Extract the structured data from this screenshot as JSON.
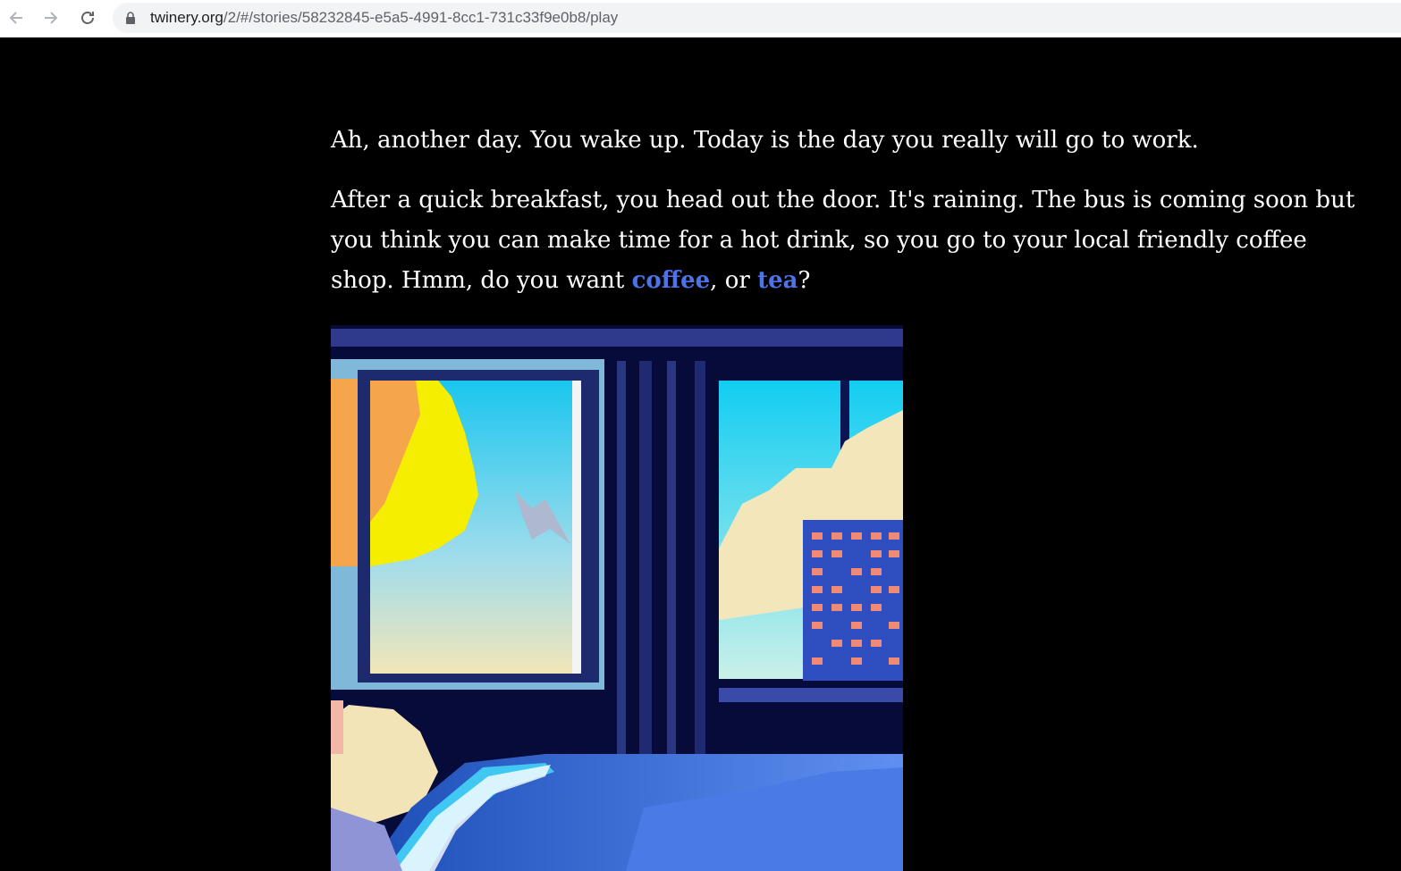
{
  "browser": {
    "url_host": "twinery.org",
    "url_path": "/2/#/stories/58232845-e5a5-4991-8cc1-731c33f9e0b8/play",
    "back_icon": "arrow-left-icon",
    "forward_icon": "arrow-right-icon",
    "reload_icon": "reload-icon",
    "lock_icon": "lock-icon"
  },
  "story": {
    "paragraph1": "Ah, another day. You wake up. Today is the day you really will go to work.",
    "paragraph2_before": "After a quick breakfast, you head out the door. It's raining. The bus is coming soon but you think you can make time for a hot drink, so you go to your local friendly coffee shop. Hmm, do you want ",
    "link_coffee": "coffee",
    "paragraph2_middle": ", or ",
    "link_tea": "tea",
    "paragraph2_after": "?",
    "link_color": "#4e73e8"
  }
}
